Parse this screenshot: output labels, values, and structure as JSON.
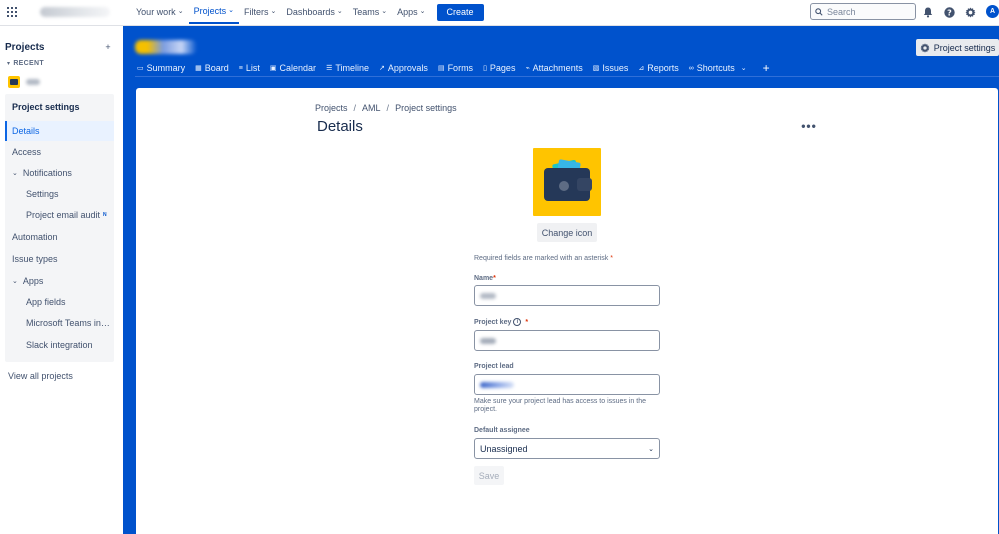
{
  "topnav": {
    "items": [
      {
        "label": "Your work",
        "active": false
      },
      {
        "label": "Projects",
        "active": true
      },
      {
        "label": "Filters",
        "active": false
      },
      {
        "label": "Dashboards",
        "active": false
      },
      {
        "label": "Teams",
        "active": false
      },
      {
        "label": "Apps",
        "active": false
      }
    ],
    "create_label": "Create",
    "search_placeholder": "Search",
    "avatar_initial": "A"
  },
  "sidebar": {
    "title": "Projects",
    "recent_label": "RECENT",
    "items": [
      {
        "label": "Project settings"
      },
      {
        "label": "Details"
      },
      {
        "label": "Access"
      },
      {
        "label": "Notifications"
      },
      {
        "label": "Settings"
      },
      {
        "label": "Project email audit"
      },
      {
        "label": "Automation"
      },
      {
        "label": "Issue types"
      },
      {
        "label": "Apps"
      },
      {
        "label": "App fields"
      },
      {
        "label": "Microsoft Teams integration"
      },
      {
        "label": "Slack integration"
      }
    ],
    "new_badge": "N",
    "view_all": "View all projects"
  },
  "project": {
    "settings_button": "Project settings",
    "tabs": [
      "Summary",
      "Board",
      "List",
      "Calendar",
      "Timeline",
      "Approvals",
      "Forms",
      "Pages",
      "Attachments",
      "Issues",
      "Reports",
      "Shortcuts"
    ]
  },
  "main": {
    "breadcrumb": [
      "Projects",
      "AML",
      "Project settings"
    ],
    "title": "Details",
    "change_icon": "Change icon",
    "required_note": "Required fields are marked with an asterisk",
    "name_label": "Name",
    "key_label": "Project key",
    "lead_label": "Project lead",
    "lead_help": "Make sure your project lead has access to issues in the project.",
    "assignee_label": "Default assignee",
    "assignee_value": "Unassigned",
    "save_label": "Save"
  },
  "colors": {
    "brand_blue": "#0052cc",
    "project_icon_yellow": "#ffc400",
    "required": "#de350b"
  }
}
